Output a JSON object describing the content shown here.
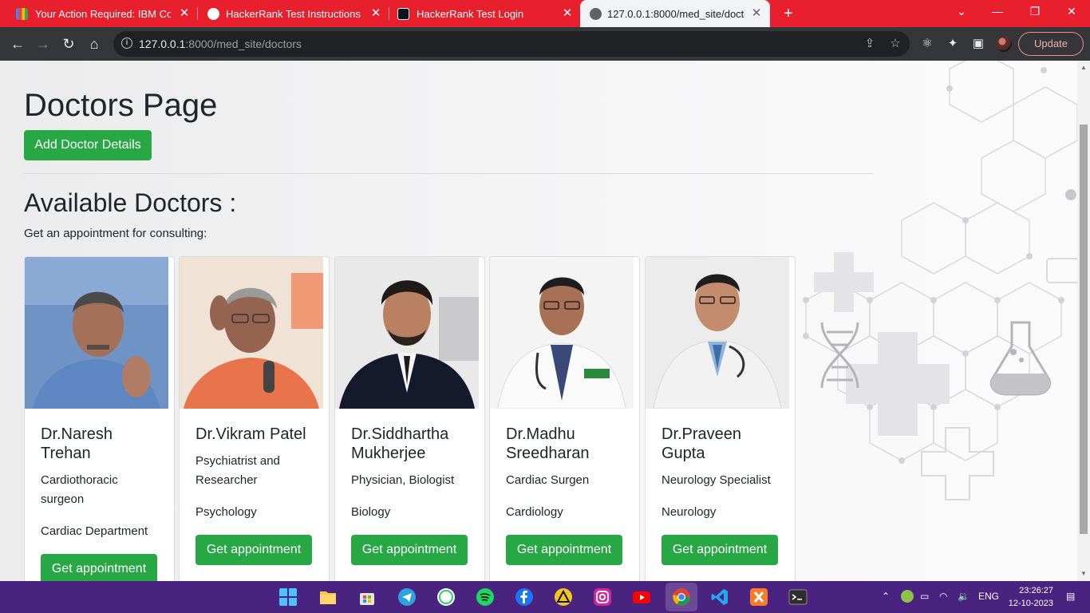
{
  "browser": {
    "tabs": [
      {
        "title": "Your Action Required: IBM Co",
        "active": false
      },
      {
        "title": "HackerRank Test Instructions",
        "active": false
      },
      {
        "title": "HackerRank Test Login",
        "active": false
      },
      {
        "title": "127.0.0.1:8000/med_site/docto",
        "active": true
      }
    ],
    "url_host": "127.0.0.1",
    "url_path": ":8000/med_site/doctors",
    "update_label": "Update"
  },
  "page": {
    "title": "Doctors Page",
    "add_button": "Add Doctor Details",
    "section_title": "Available Doctors :",
    "section_subtitle": "Get an appointment for consulting:",
    "doctors": [
      {
        "name": "Dr.Naresh Trehan",
        "role": "Cardiothoracic surgeon",
        "department": "Cardiac Department",
        "button": "Get appointment"
      },
      {
        "name": "Dr.Vikram Patel",
        "role": "Psychiatrist and Researcher",
        "department": "Psychology",
        "button": "Get appointment"
      },
      {
        "name": "Dr.Siddhartha Mukherjee",
        "role": "Physician, Biologist",
        "department": "Biology",
        "button": "Get appointment"
      },
      {
        "name": "Dr.Madhu Sreedharan",
        "role": "Cardiac Surgen",
        "department": "Cardiology",
        "button": "Get appointment"
      },
      {
        "name": "Dr.Praveen Gupta",
        "role": "Neurology Specialist",
        "department": "Neurology",
        "button": "Get appointment"
      }
    ]
  },
  "taskbar": {
    "language": "ENG",
    "time": "23:26:27",
    "date": "12-10-2023"
  },
  "colors": {
    "tabstrip": "#e8202e",
    "toolbar": "#35363a",
    "button_green": "#28a745",
    "taskbar": "#4a2280"
  }
}
